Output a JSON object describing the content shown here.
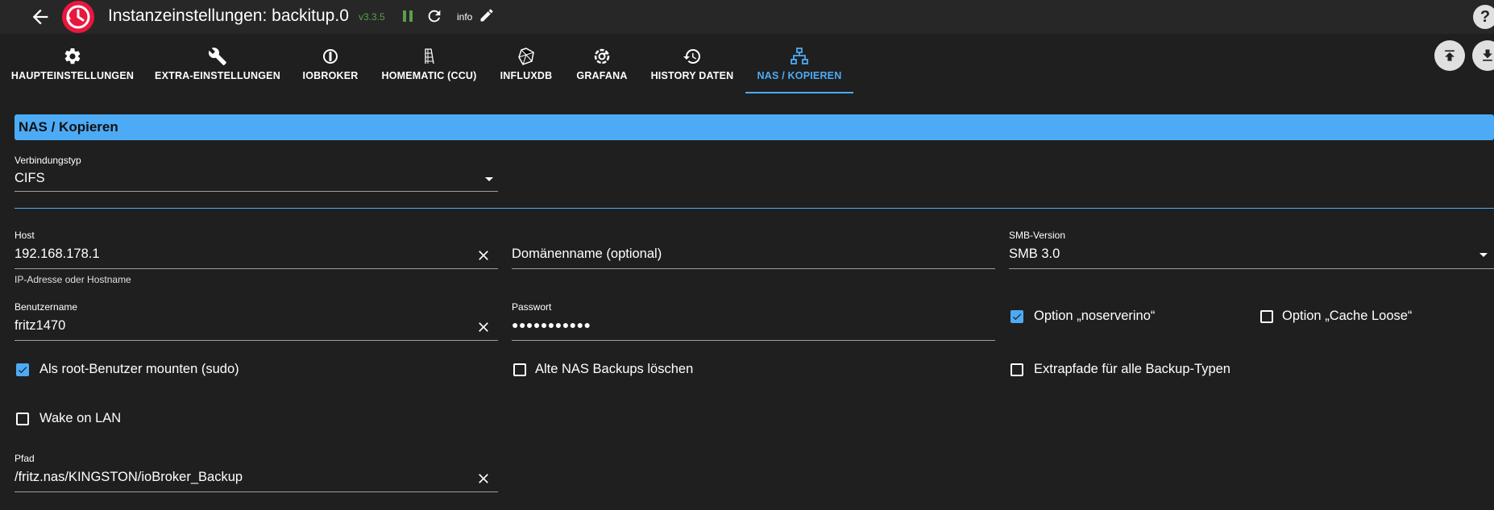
{
  "window": {
    "title": "Instanzeinstellungen: backitup.0",
    "version": "v3.3.5",
    "info_label": "info",
    "help_label": "?"
  },
  "colors": {
    "accent": "#4dabf5",
    "background": "#1f1f1f",
    "topbar": "#272727",
    "logo_red": "#e8173e",
    "version_green": "#5c9e4e"
  },
  "tabs": [
    {
      "label": "HAUPTEINSTELLUNGEN",
      "icon": "gear-icon"
    },
    {
      "label": "EXTRA-EINSTELLUNGEN",
      "icon": "wrench-icon"
    },
    {
      "label": "IOBROKER",
      "icon": "iobroker-icon"
    },
    {
      "label": "HOMEMATIC (CCU)",
      "icon": "homematic-icon"
    },
    {
      "label": "INFLUXDB",
      "icon": "influxdb-icon"
    },
    {
      "label": "GRAFANA",
      "icon": "grafana-icon"
    },
    {
      "label": "HISTORY DATEN",
      "icon": "history-icon"
    },
    {
      "label": "NAS / KOPIEREN",
      "icon": "network-icon"
    }
  ],
  "active_tab": "NAS / KOPIEREN",
  "section": {
    "title": "NAS / Kopieren"
  },
  "form": {
    "connection_type": {
      "label": "Verbindungstyp",
      "value": "CIFS"
    },
    "host": {
      "label": "Host",
      "value": "192.168.178.1",
      "helper": "IP-Adresse oder Hostname"
    },
    "domain": {
      "placeholder": "Domänenname (optional)"
    },
    "smb_version": {
      "label": "SMB-Version",
      "value": "SMB 3.0"
    },
    "username": {
      "label": "Benutzername",
      "value": "fritz1470"
    },
    "password": {
      "label": "Passwort",
      "value": "●●●●●●●●●●●"
    },
    "noserverino": {
      "label": "Option „noserverino“",
      "checked": true
    },
    "cache_loose": {
      "label": "Option „Cache Loose“",
      "checked": false
    },
    "sudo": {
      "label": "Als root-Benutzer mounten (sudo)",
      "checked": true
    },
    "delete_old": {
      "label": "Alte NAS Backups löschen",
      "checked": false
    },
    "extra_paths": {
      "label": "Extrapfade für alle Backup-Typen",
      "checked": false
    },
    "wake_on_lan": {
      "label": "Wake on LAN",
      "checked": false
    },
    "path": {
      "label": "Pfad",
      "value": "/fritz.nas/KINGSTON/ioBroker_Backup"
    }
  }
}
